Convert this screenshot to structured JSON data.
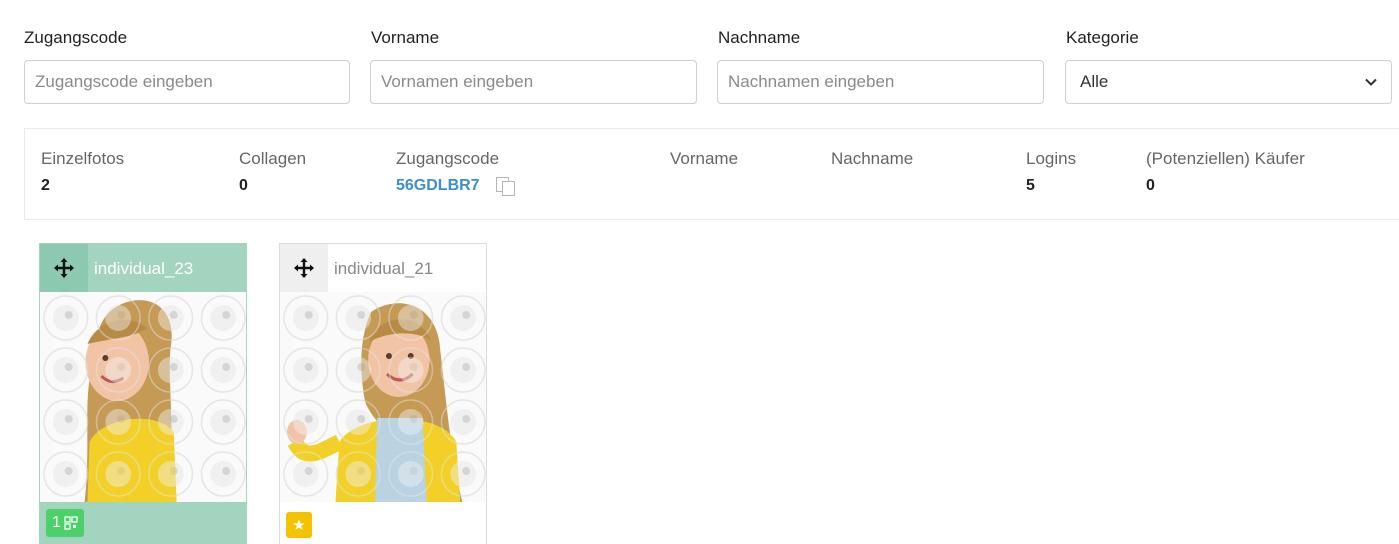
{
  "filters": {
    "access_code": {
      "label": "Zugangscode",
      "placeholder": "Zugangscode eingeben"
    },
    "first_name": {
      "label": "Vorname",
      "placeholder": "Vornamen eingeben"
    },
    "last_name": {
      "label": "Nachname",
      "placeholder": "Nachnamen eingeben"
    },
    "category": {
      "label": "Kategorie",
      "selected": "Alle"
    }
  },
  "summary": {
    "single_photos": {
      "label": "Einzelfotos",
      "value": "2"
    },
    "collages": {
      "label": "Collagen",
      "value": "0"
    },
    "access_code": {
      "label": "Zugangscode",
      "value": "56GDLBR7"
    },
    "first_name": {
      "label": "Vorname",
      "value": ""
    },
    "last_name": {
      "label": "Nachname",
      "value": ""
    },
    "logins": {
      "label": "Logins",
      "value": "5"
    },
    "buyers": {
      "label": "(Potenziellen) Käufer",
      "value": "0"
    }
  },
  "photos": [
    {
      "title": "individual_23",
      "selected": true,
      "badge_count": "1",
      "badge_icon": "qr-code-icon"
    },
    {
      "title": "individual_21",
      "selected": false,
      "badge_icon": "star-icon",
      "badge_symbol": "★"
    }
  ],
  "colors": {
    "selected_card": "#a3d4c0",
    "code_link": "#3a8fd0",
    "count_badge": "#4cd06a",
    "star_badge": "#f5c200"
  }
}
